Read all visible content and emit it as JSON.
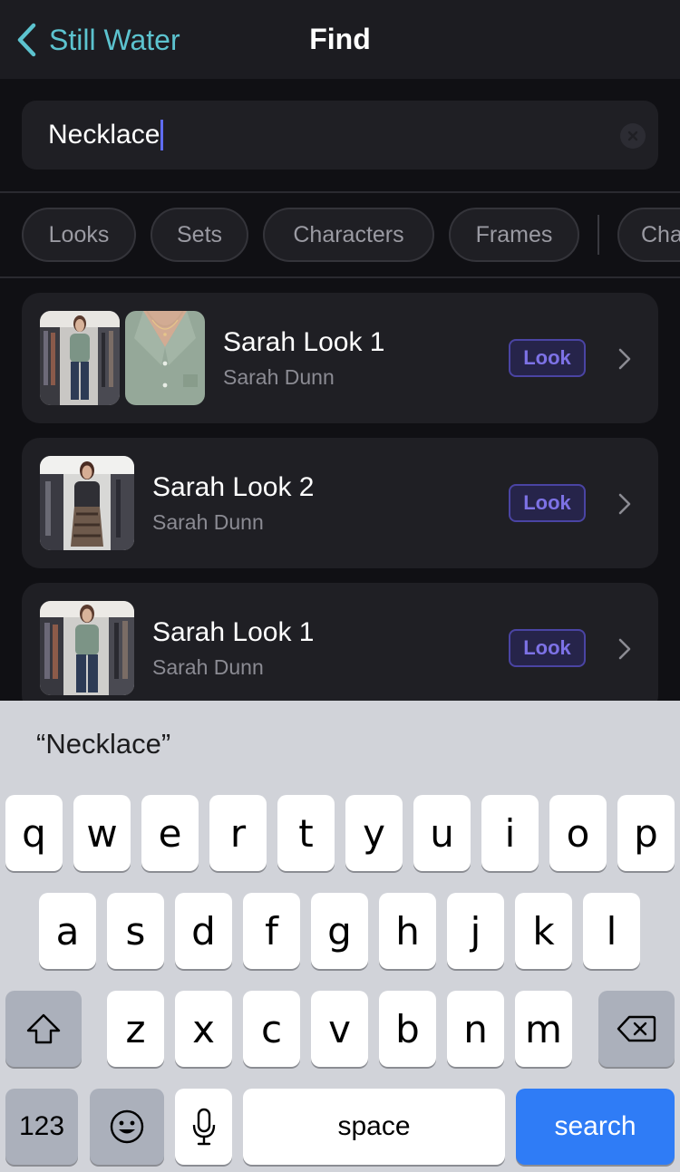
{
  "header": {
    "back_label": "Still Water",
    "title": "Find"
  },
  "search": {
    "value": "Necklace"
  },
  "filters": [
    "Looks",
    "Sets",
    "Characters",
    "Frames",
    "Cha"
  ],
  "results": [
    {
      "title": "Sarah Look 1",
      "subtitle": "Sarah Dunn",
      "badge": "Look"
    },
    {
      "title": "Sarah Look 2",
      "subtitle": "Sarah Dunn",
      "badge": "Look"
    },
    {
      "title": "Sarah Look 1",
      "subtitle": "Sarah Dunn",
      "badge": "Look"
    }
  ],
  "keyboard": {
    "suggestion": "“Necklace”",
    "row1": [
      "q",
      "w",
      "e",
      "r",
      "t",
      "y",
      "u",
      "i",
      "o",
      "p"
    ],
    "row2": [
      "a",
      "s",
      "d",
      "f",
      "g",
      "h",
      "j",
      "k",
      "l"
    ],
    "row3": [
      "z",
      "x",
      "c",
      "v",
      "b",
      "n",
      "m"
    ],
    "numbers_label": "123",
    "space_label": "space",
    "search_label": "search"
  },
  "colors": {
    "accent_teal": "#5cc3cf",
    "badge_purple": "#7d72e6",
    "keyboard_blue": "#2f7cf6"
  }
}
